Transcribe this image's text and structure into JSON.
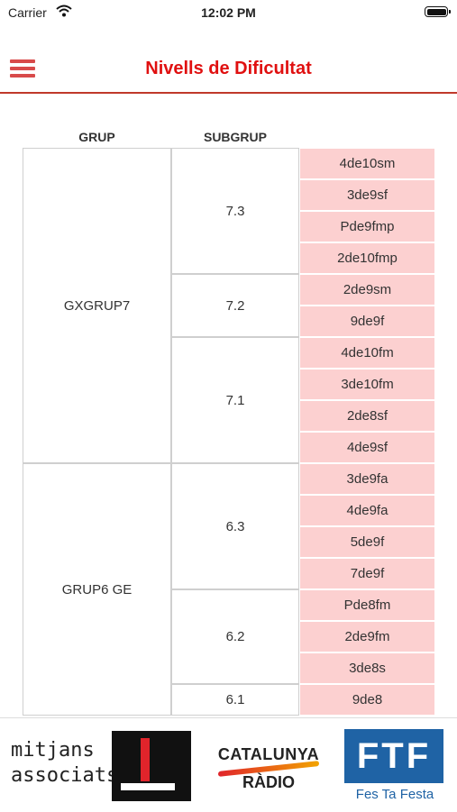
{
  "status_bar": {
    "carrier": "Carrier",
    "time": "12:02 PM"
  },
  "nav": {
    "title": "Nivells de Dificultat"
  },
  "table": {
    "headers": {
      "grup": "GRUP",
      "subgrup": "SUBGRUP"
    },
    "groups": [
      {
        "name": "GXGRUP7",
        "subgroups": [
          {
            "name": "7.3",
            "levels": [
              "4de10sm",
              "3de9sf",
              "Pde9fmp",
              "2de10fmp"
            ]
          },
          {
            "name": "7.2",
            "levels": [
              "2de9sm",
              "9de9f"
            ]
          },
          {
            "name": "7.1",
            "levels": [
              "4de10fm",
              "3de10fm",
              "2de8sf",
              "4de9sf"
            ]
          }
        ]
      },
      {
        "name": "GRUP6 GE",
        "subgroups": [
          {
            "name": "6.3",
            "levels": [
              "3de9fa",
              "4de9fa",
              "5de9f",
              "7de9f"
            ]
          },
          {
            "name": "6.2",
            "levels": [
              "Pde8fm",
              "2de9fm",
              "3de8s"
            ]
          },
          {
            "name": "6.1",
            "levels": [
              "9de8"
            ]
          }
        ]
      }
    ]
  },
  "footer": {
    "mitjans": [
      "mitjans",
      "associats"
    ],
    "catalunya": [
      "CATALUNYA",
      "RÀDIO"
    ],
    "ftf": {
      "logo": "FTF",
      "sub": "Fes Ta Festa"
    }
  },
  "colors": {
    "accent": "#e01010",
    "level_bg": "#fcd0d0"
  },
  "icons": [
    "wifi-icon",
    "battery-icon",
    "menu-icon"
  ]
}
